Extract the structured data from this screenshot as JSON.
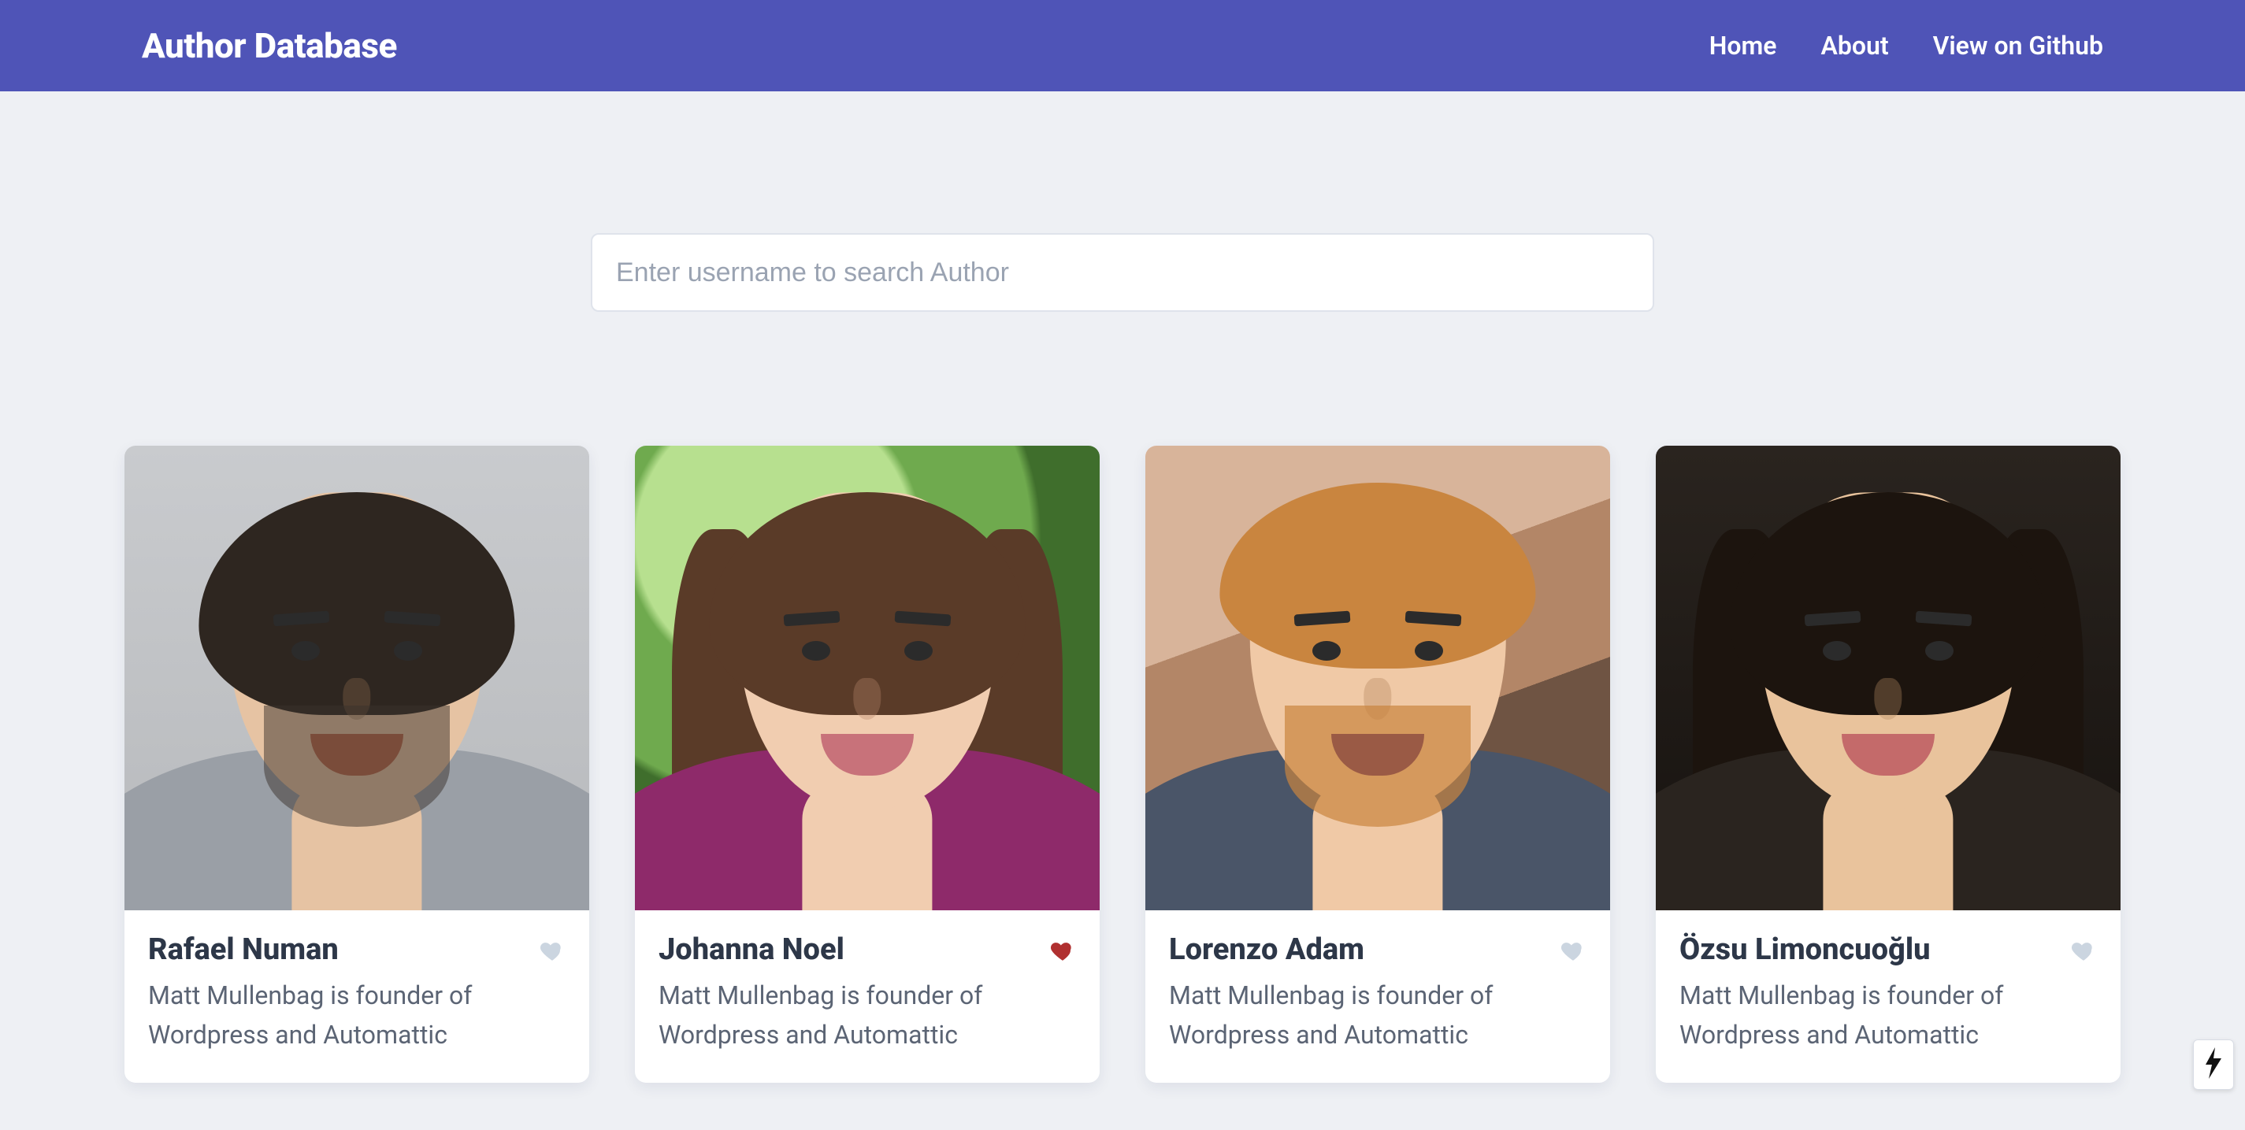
{
  "header": {
    "brand": "Author Database",
    "links": [
      "Home",
      "About",
      "View on Github"
    ]
  },
  "search": {
    "placeholder": "Enter username to search Author",
    "value": ""
  },
  "authors": [
    {
      "name": "Rafael Numan",
      "desc": "Matt Mullenbag is founder of Wordpress and Automattic",
      "favorited": false
    },
    {
      "name": "Johanna Noel",
      "desc": "Matt Mullenbag is founder of Wordpress and Automattic",
      "favorited": true
    },
    {
      "name": "Lorenzo Adam",
      "desc": "Matt Mullenbag is founder of Wordpress and Automattic",
      "favorited": false
    },
    {
      "name": "Özsu Limoncuoğlu",
      "desc": "Matt Mullenbag is founder of Wordpress and Automattic",
      "favorited": false
    }
  ],
  "colors": {
    "primary": "#4f54b7",
    "heart_off": "#cbd5e0",
    "heart_on": "#b03030"
  }
}
